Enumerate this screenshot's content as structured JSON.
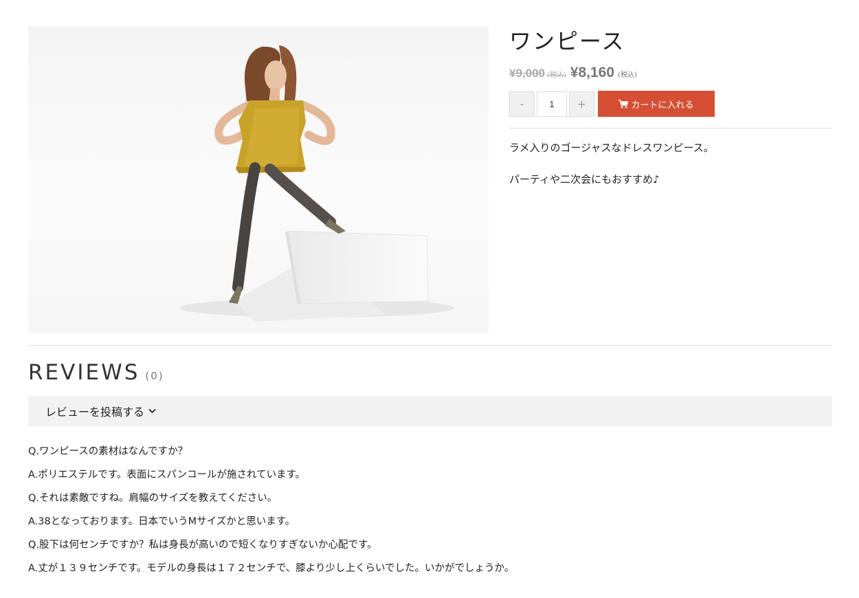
{
  "product": {
    "title": "ワンピース",
    "old_price": "¥9,000",
    "old_tax_label": "(税込)",
    "price": "¥8,160",
    "tax_label": "(税込)",
    "image_icon": "model-photo-yellow-dress",
    "description": [
      "ラメ入りのゴージャスなドレスワンピース。",
      "パーティや二次会にもおすすめ♪"
    ]
  },
  "cart": {
    "minus_label": "-",
    "plus_label": "+",
    "quantity": "1",
    "add_label": "カートに入れる",
    "button_color": "#d64f35"
  },
  "reviews": {
    "title": "REVIEWS",
    "count": "(0)",
    "post_label": "レビューを投稿する"
  },
  "qa": [
    "Q.ワンピースの素材はなんですか？",
    "A.ポリエステルです。表面にスパンコールが施されています。",
    "Q.それは素敵ですね。肩幅のサイズを教えてください。",
    "A.38となっております。日本でいうMサイズかと思います。",
    "Q.股下は何センチですか？私は身長が高いので短くなりすぎないか心配です。",
    "A.丈が１３９センチです。モデルの身長は１７２センチで、膝より少し上くらいでした。いかがでしょうか。"
  ]
}
